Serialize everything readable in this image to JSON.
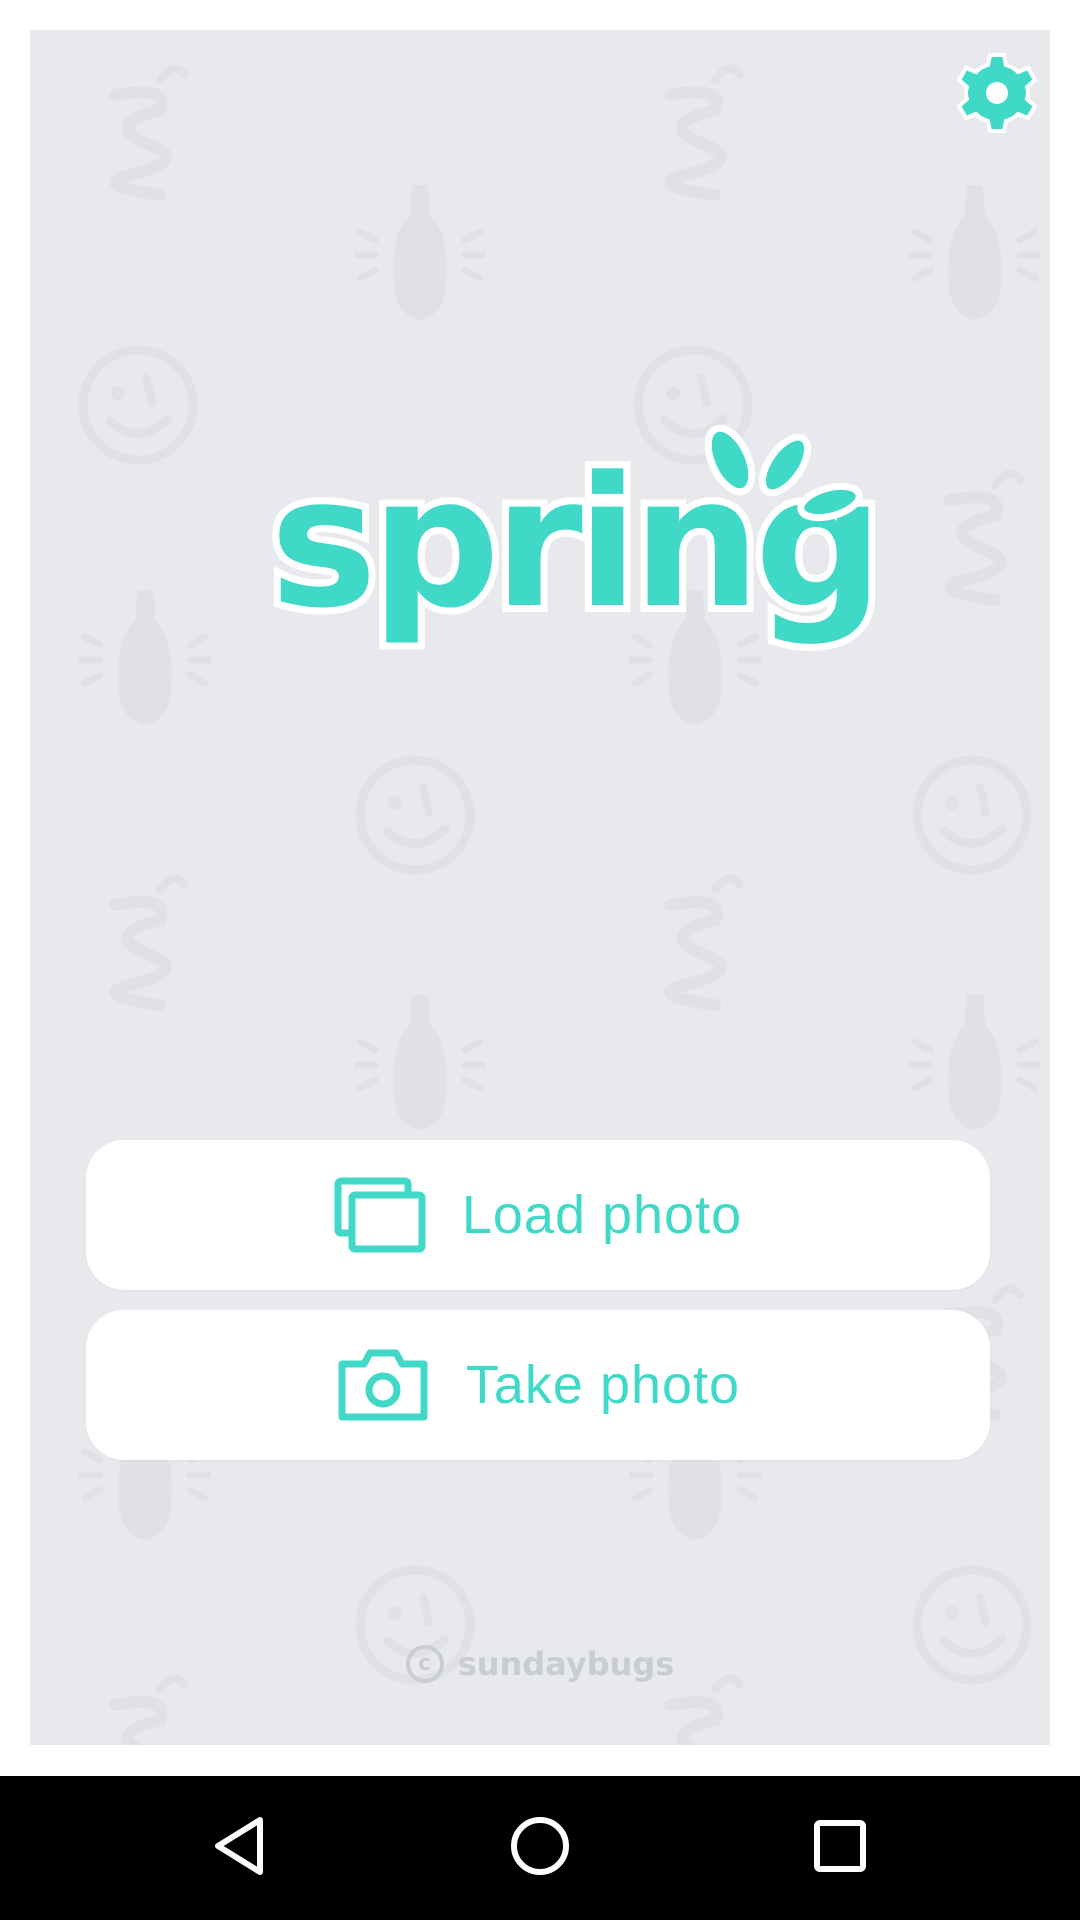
{
  "app": {
    "logo_text": "spring",
    "accent_color": "#40d9c8",
    "background_color": "#e8e9ec"
  },
  "header": {
    "settings_icon": "gear-icon"
  },
  "actions": {
    "load_photo": {
      "label": "Load photo",
      "icon": "gallery-icon"
    },
    "take_photo": {
      "label": "Take photo",
      "icon": "camera-icon"
    }
  },
  "footer": {
    "copyright_symbol": "c",
    "company": "sundaybugs"
  },
  "navbar": {
    "back_icon": "back-triangle-icon",
    "home_icon": "home-circle-icon",
    "recent_icon": "recent-square-icon"
  }
}
